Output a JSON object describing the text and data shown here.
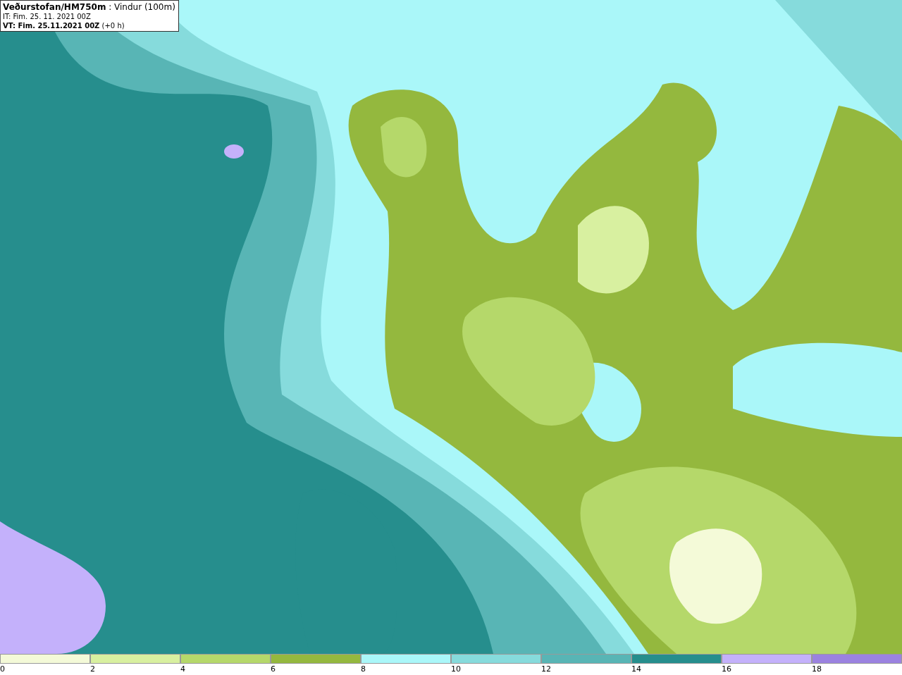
{
  "header": {
    "title_line": "**Veðurstofan/HM750m** : Vindur (100m)",
    "issue_time": "IT: Fim. 25. 11. 2021 00Z",
    "valid_time": "**VT: Fim. 25.11.2021 00Z** (+0 h)"
  },
  "legend": [
    {
      "label": "0",
      "color": "#f4fad8"
    },
    {
      "label": "2",
      "color": "#d8f0a0"
    },
    {
      "label": "4",
      "color": "#b5d86a"
    },
    {
      "label": "6",
      "color": "#94b83e"
    },
    {
      "label": "8",
      "color": "#aaf7f9"
    },
    {
      "label": "10",
      "color": "#86dbdc"
    },
    {
      "label": "12",
      "color": "#58b5b5"
    },
    {
      "label": "14",
      "color": "#268e8d"
    },
    {
      "label": "16",
      "color": "#c4b1fb"
    },
    {
      "label": "18",
      "color": "#9b82e0"
    }
  ]
}
